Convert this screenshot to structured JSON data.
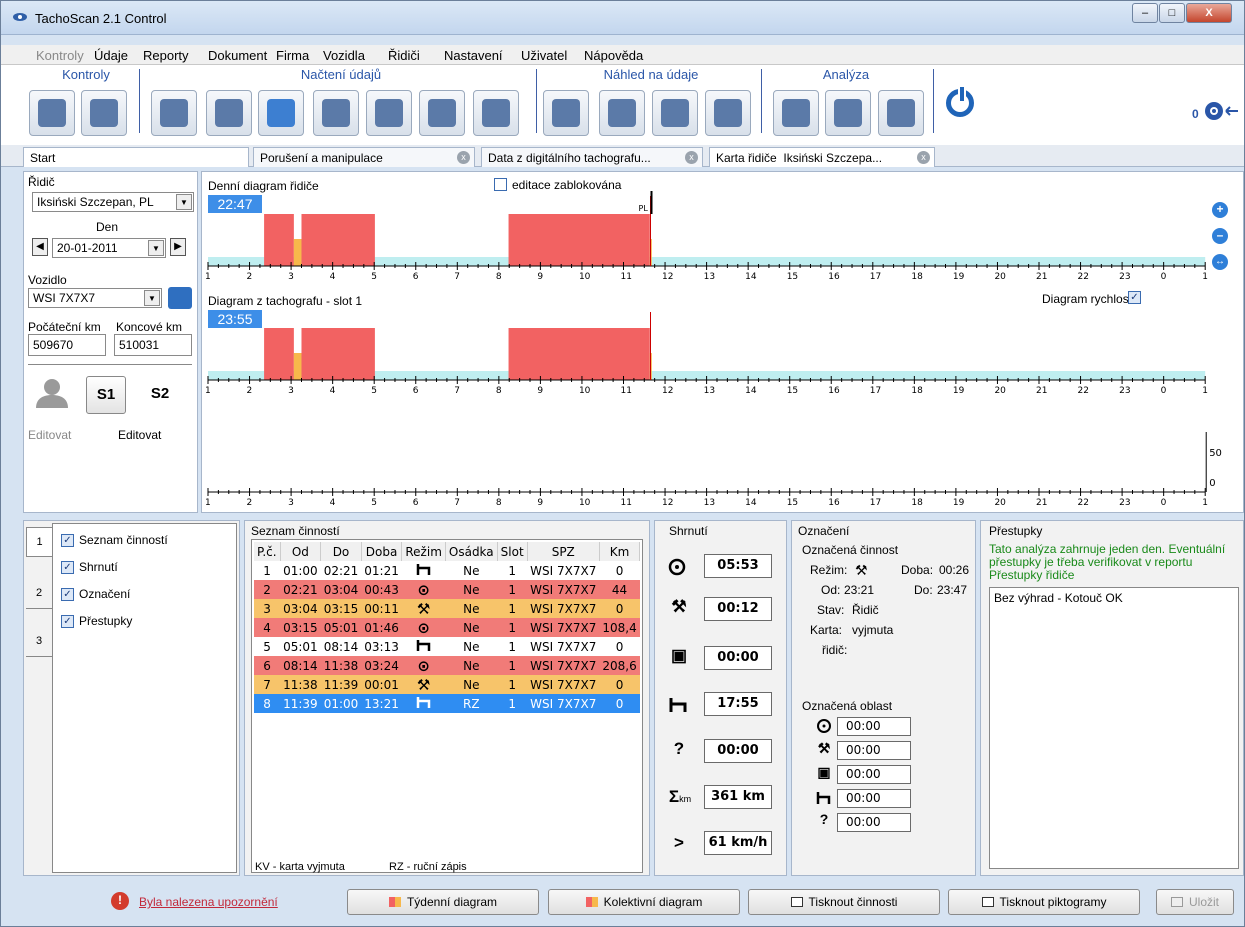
{
  "window": {
    "title": "TachoScan 2.1 Control"
  },
  "menu": [
    "Kontroly",
    "Údaje",
    "Reporty",
    "Dokument",
    "Firma",
    "Vozidla",
    "Řidiči",
    "Nastavení",
    "Uživatel",
    "Nápověda"
  ],
  "ribbon": {
    "groups": [
      "Kontroly",
      "Načtení údajů",
      "Náhled na údaje",
      "Analýza"
    ],
    "counter": "0"
  },
  "tabs": [
    "Start",
    "Porušení a manipulace",
    "Data z digitálního tachografu...",
    "Karta řidiče",
    "Iksiński Szczepa..."
  ],
  "left": {
    "driver_label": "Řidič",
    "driver_value": "Iksiński Szczepan, PL",
    "day_label": "Den",
    "day_value": "20-01-2011",
    "vehicle_label": "Vozidlo",
    "vehicle_value": "WSI 7X7X7",
    "start_km_label": "Počáteční km",
    "start_km": "509670",
    "end_km_label": "Koncové km",
    "end_km": "510031",
    "s1": "S1",
    "s2": "S2",
    "edit1": "Editovat",
    "edit2": "Editovat"
  },
  "center": {
    "diagram1_title": "Denní diagram řidiče",
    "diagram1_time": "22:47",
    "locked_label": "editace zablokována",
    "pl_marker": "PL",
    "diagram2_title": "Diagram z tachografu - slot 1",
    "diagram2_time": "23:55",
    "speed_label": "Diagram rychlosti",
    "speed_ticks": [
      "50",
      "0"
    ],
    "hours": [
      "1",
      "2",
      "3",
      "4",
      "5",
      "6",
      "7",
      "8",
      "9",
      "10",
      "11",
      "12",
      "13",
      "14",
      "15",
      "16",
      "17",
      "18",
      "19",
      "20",
      "21",
      "22",
      "23",
      "0",
      "1"
    ]
  },
  "options": {
    "side_tabs": [
      "1",
      "2",
      "3"
    ],
    "items": [
      "Seznam činností",
      "Shrnutí",
      "Označení",
      "Přestupky"
    ]
  },
  "activities": {
    "title": "Seznam činností",
    "headers": [
      "P.č.",
      "Od",
      "Do",
      "Doba",
      "Režim",
      "Osádka",
      "Slot",
      "SPZ",
      "Km"
    ],
    "rows": [
      {
        "n": "1",
        "od": "01:00",
        "do": "02:21",
        "doba": "01:21",
        "rezim": "rest",
        "osadka": "Ne",
        "slot": "1",
        "spz": "WSI 7X7X7",
        "km": "0",
        "cls": "r-white"
      },
      {
        "n": "2",
        "od": "02:21",
        "do": "03:04",
        "doba": "00:43",
        "rezim": "drive",
        "osadka": "Ne",
        "slot": "1",
        "spz": "WSI 7X7X7",
        "km": "44",
        "cls": "r-red"
      },
      {
        "n": "3",
        "od": "03:04",
        "do": "03:15",
        "doba": "00:11",
        "rezim": "work",
        "osadka": "Ne",
        "slot": "1",
        "spz": "WSI 7X7X7",
        "km": "0",
        "cls": "r-org"
      },
      {
        "n": "4",
        "od": "03:15",
        "do": "05:01",
        "doba": "01:46",
        "rezim": "drive",
        "osadka": "Ne",
        "slot": "1",
        "spz": "WSI 7X7X7",
        "km": "108,4",
        "cls": "r-red"
      },
      {
        "n": "5",
        "od": "05:01",
        "do": "08:14",
        "doba": "03:13",
        "rezim": "rest",
        "osadka": "Ne",
        "slot": "1",
        "spz": "WSI 7X7X7",
        "km": "0",
        "cls": "r-white"
      },
      {
        "n": "6",
        "od": "08:14",
        "do": "11:38",
        "doba": "03:24",
        "rezim": "drive",
        "osadka": "Ne",
        "slot": "1",
        "spz": "WSI 7X7X7",
        "km": "208,6",
        "cls": "r-red"
      },
      {
        "n": "7",
        "od": "11:38",
        "do": "11:39",
        "doba": "00:01",
        "rezim": "work",
        "osadka": "Ne",
        "slot": "1",
        "spz": "WSI 7X7X7",
        "km": "0",
        "cls": "r-org"
      },
      {
        "n": "8",
        "od": "11:39",
        "do": "01:00",
        "doba": "13:21",
        "rezim": "rest",
        "osadka": "RZ",
        "slot": "1",
        "spz": "WSI 7X7X7",
        "km": "0",
        "cls": "r-sel"
      }
    ],
    "legend_kv": "KV - karta vyjmuta",
    "legend_rz": "RZ - ruční zápis"
  },
  "summary": {
    "title": "Shrnutí",
    "drive": "05:53",
    "work": "00:12",
    "avail": "00:00",
    "rest": "17:55",
    "unknown": "00:00",
    "km": "361 km",
    "speed": "61 km/h"
  },
  "marking": {
    "title": "Označení",
    "activity_title": "Označená činnost",
    "mode_label": "Režim:",
    "duration_label": "Doba:",
    "duration": "00:26",
    "from_label": "Od:",
    "from": "23:21",
    "to_label": "Do:",
    "to": "23:47",
    "state_label": "Stav:",
    "state": "Řidič",
    "card_label": "Karta:",
    "card": "vyjmuta",
    "driver_label": "řidič:",
    "area_title": "Označená oblast",
    "area": [
      "00:00",
      "00:00",
      "00:00",
      "00:00",
      "00:00"
    ]
  },
  "violations": {
    "title": "Přestupky",
    "note": "Tato analýza zahrnuje jeden den. Eventuální přestupky je třeba verifikovat v reportu Přestupky řidiče",
    "result": "Bez výhrad - Kotouč OK"
  },
  "footer": {
    "warning": "Byla nalezena upozornění",
    "weekly": "Týdenní diagram",
    "collective": "Kolektivní diagram",
    "print_act": "Tisknout činnosti",
    "print_pict": "Tisknout piktogramy",
    "save": "Uložit"
  },
  "colors": {
    "drive": "#f26262",
    "work": "#f7b84b",
    "rest": "#bfeef0",
    "accent": "#3d8ee8"
  }
}
